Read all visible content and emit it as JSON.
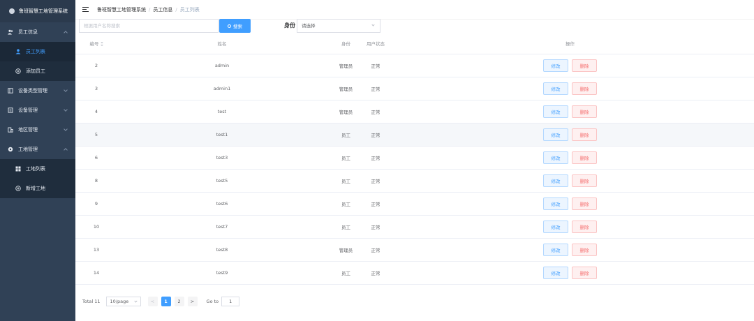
{
  "app": {
    "title": "鲁班智慧工地管理系统"
  },
  "sidebar": {
    "items": [
      {
        "label": "员工信息",
        "icon": "user-group-icon",
        "expanded": true,
        "children": [
          {
            "label": "员工列表",
            "icon": "user-icon",
            "active": true
          },
          {
            "label": "添加员工",
            "icon": "plus-circle-icon"
          }
        ]
      },
      {
        "label": "设备类型管理",
        "icon": "device-type-icon",
        "expanded": false
      },
      {
        "label": "设备管理",
        "icon": "device-icon",
        "expanded": false
      },
      {
        "label": "地区管理",
        "icon": "building-icon",
        "expanded": false
      },
      {
        "label": "工地管理",
        "icon": "gear-icon",
        "expanded": true,
        "children": [
          {
            "label": "工地列表",
            "icon": "grid-icon"
          },
          {
            "label": "新增工地",
            "icon": "plus-circle-icon"
          }
        ]
      }
    ]
  },
  "breadcrumb": [
    "鲁班智慧工地管理系统",
    "员工信息",
    "员工列表"
  ],
  "search": {
    "placeholder": "根据用户名称搜索",
    "button_label": "搜索",
    "identity_label": "身份",
    "identity_value": "请选择"
  },
  "table": {
    "columns": [
      "编号",
      "姓名",
      "身份",
      "用户状态",
      "操作"
    ],
    "edit_label": "修改",
    "delete_label": "删除",
    "rows": [
      {
        "id": "2",
        "name": "admin",
        "role": "管理员",
        "status": "正常"
      },
      {
        "id": "3",
        "name": "admin1",
        "role": "管理员",
        "status": "正常"
      },
      {
        "id": "4",
        "name": "test",
        "role": "管理员",
        "status": "正常"
      },
      {
        "id": "5",
        "name": "test1",
        "role": "员工",
        "status": "正常"
      },
      {
        "id": "6",
        "name": "test3",
        "role": "员工",
        "status": "正常"
      },
      {
        "id": "8",
        "name": "test5",
        "role": "员工",
        "status": "正常"
      },
      {
        "id": "9",
        "name": "test6",
        "role": "员工",
        "status": "正常"
      },
      {
        "id": "10",
        "name": "test7",
        "role": "员工",
        "status": "正常"
      },
      {
        "id": "13",
        "name": "test8",
        "role": "管理员",
        "status": "正常"
      },
      {
        "id": "14",
        "name": "test9",
        "role": "员工",
        "status": "正常"
      }
    ]
  },
  "pagination": {
    "total": "Total 11",
    "page_size": "10/page",
    "prev": "<",
    "pages": [
      "1",
      "2"
    ],
    "next": ">",
    "goto_label": "Go to",
    "goto_value": "1"
  },
  "colors": {
    "sidebar": "#304156",
    "accent": "#409eff",
    "danger": "#f56c6c"
  }
}
